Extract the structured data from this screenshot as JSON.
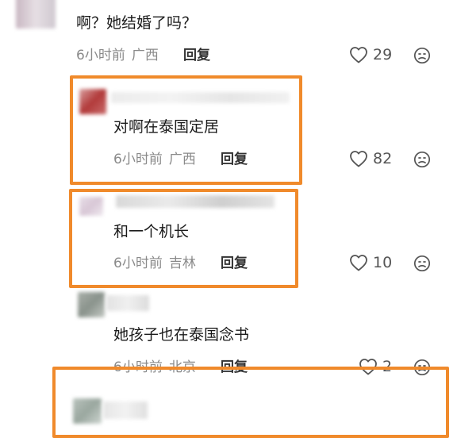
{
  "comments": [
    {
      "text": "啊？她结婚了吗？",
      "time": "6小时前",
      "location": "广西",
      "reply_label": "回复",
      "likes": "29"
    },
    {
      "text": "对啊在泰国定居",
      "time": "6小时前",
      "location": "广西",
      "reply_label": "回复",
      "likes": "82"
    },
    {
      "text": "和一个机长",
      "time": "6小时前",
      "location": "吉林",
      "reply_label": "回复",
      "likes": "10"
    },
    {
      "text": "她孩子也在泰国念书",
      "time": "6小时前",
      "location": "北京",
      "reply_label": "回复",
      "likes": "2"
    }
  ],
  "colors": {
    "highlight": "#f08a2b",
    "meta_text": "#8a8a8a",
    "reply_text": "#333333"
  },
  "icons": {
    "like": "heart-outline-icon",
    "dislike": "frown-face-icon"
  }
}
